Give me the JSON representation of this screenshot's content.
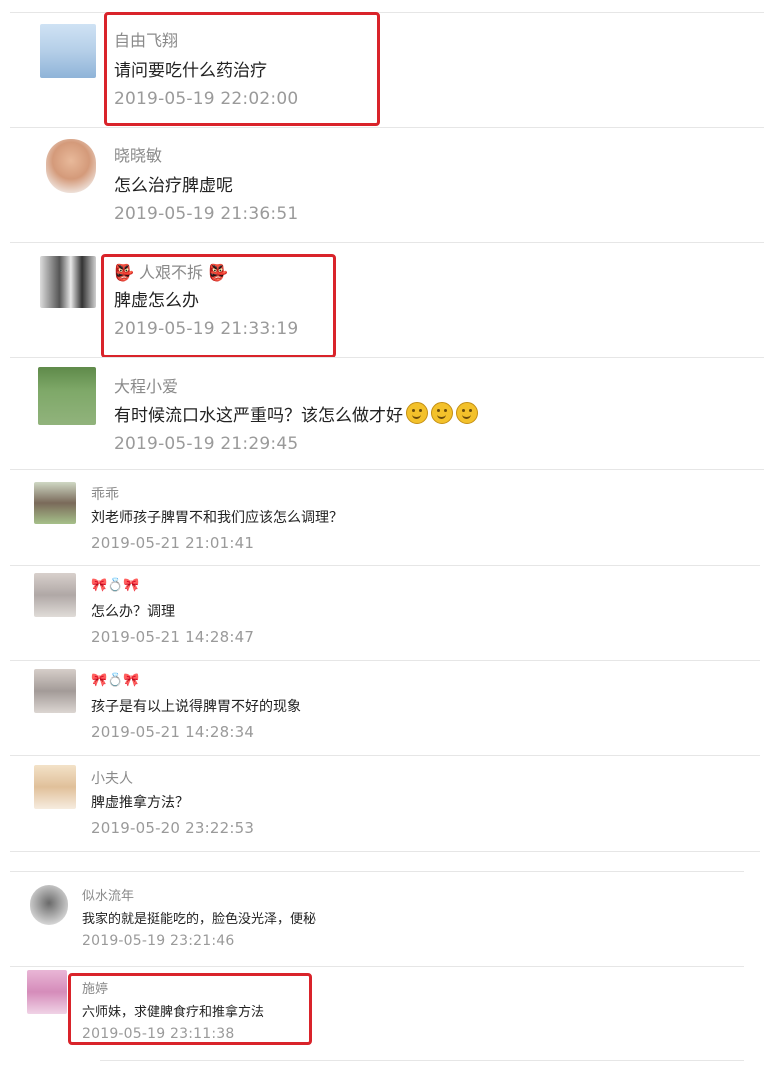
{
  "comments": [
    {
      "name": "自由飞翔",
      "text": "请问要吃什么药治疗",
      "time": "2019-05-19 22:02:00"
    },
    {
      "name": "晓晓敏",
      "text": "怎么治疗脾虚呢",
      "time": "2019-05-19 21:36:51"
    },
    {
      "name": "👺 人艰不拆 👺",
      "text": "脾虚怎么办",
      "time": "2019-05-19 21:33:19"
    },
    {
      "name": "大程小爱",
      "text": "有时候流口水这严重吗？该怎么做才好",
      "time": "2019-05-19 21:29:45"
    },
    {
      "name": "乖乖",
      "text": "刘老师孩子脾胃不和我们应该怎么调理？",
      "time": "2019-05-21 21:01:41"
    },
    {
      "name": "🎀💍🎀",
      "text": "怎么办？调理",
      "time": "2019-05-21 14:28:47"
    },
    {
      "name": "🎀💍🎀",
      "text": "孩子是有以上说得脾胃不好的现象",
      "time": "2019-05-21 14:28:34"
    },
    {
      "name": "小夫人",
      "text": "脾虚推拿方法？",
      "time": "2019-05-20 23:22:53"
    },
    {
      "name": "似水流年",
      "text": "我家的就是挺能吃的，脸色没光泽，便秘",
      "time": "2019-05-19 23:21:46"
    },
    {
      "name": "施婷",
      "text": "六师妹，求健脾食疗和推拿方法",
      "time": "2019-05-19 23:11:38"
    }
  ],
  "emoji_icons": [
    "smile-emoji",
    "smile-emoji",
    "smile-emoji"
  ],
  "colors": {
    "highlight": "#d9232a",
    "name": "#8a8a8a",
    "time": "#9a9a9a",
    "text": "#222222"
  }
}
